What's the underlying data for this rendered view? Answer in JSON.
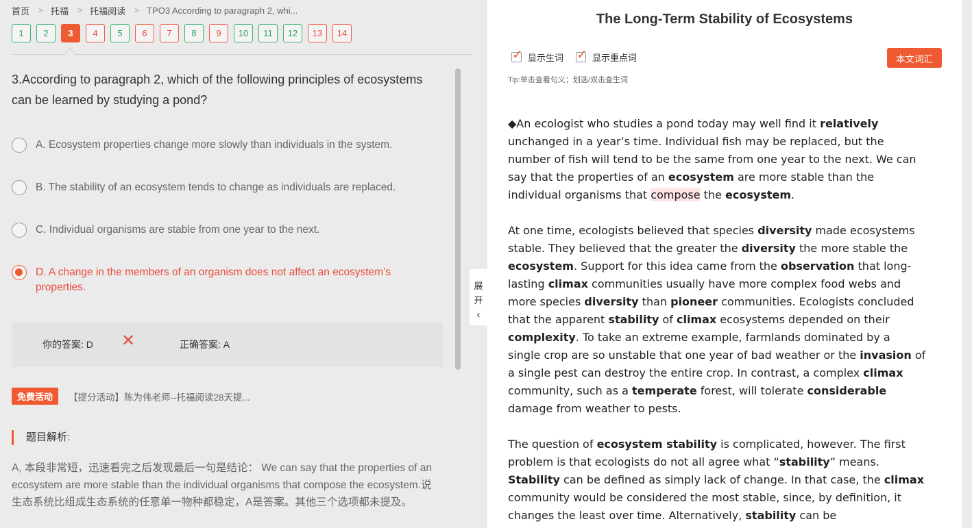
{
  "breadcrumb": {
    "items": [
      "首页",
      "托福",
      "托福阅读",
      "TPO3 According to paragraph 2, whi..."
    ],
    "separator": ">"
  },
  "question_nav": {
    "items": [
      {
        "label": "1",
        "status": "correct"
      },
      {
        "label": "2",
        "status": "correct"
      },
      {
        "label": "3",
        "status": "current"
      },
      {
        "label": "4",
        "status": "wrong"
      },
      {
        "label": "5",
        "status": "correct"
      },
      {
        "label": "6",
        "status": "wrong"
      },
      {
        "label": "7",
        "status": "wrong"
      },
      {
        "label": "8",
        "status": "correct"
      },
      {
        "label": "9",
        "status": "wrong"
      },
      {
        "label": "10",
        "status": "correct"
      },
      {
        "label": "11",
        "status": "correct"
      },
      {
        "label": "12",
        "status": "correct"
      },
      {
        "label": "13",
        "status": "wrong"
      },
      {
        "label": "14",
        "status": "wrong"
      }
    ]
  },
  "question": {
    "text": "3.According to paragraph 2, which of the following principles of ecosystems can be learned by studying a pond?",
    "options": [
      {
        "label": "A. Ecosystem properties change more slowly than individuals in the system.",
        "selected": false
      },
      {
        "label": "B. The stability of an ecosystem tends to change as individuals are replaced.",
        "selected": false
      },
      {
        "label": "C. Individual organisms are stable from one year to the next.",
        "selected": false
      },
      {
        "label": "D. A change in the members of an organism does not affect an ecosystem’s properties.",
        "selected": true
      }
    ]
  },
  "answer": {
    "your_label": "你的答案:",
    "your_value": "D",
    "result_icon": "x-icon",
    "correct_label": "正确答案:",
    "correct_value": "A"
  },
  "promo": {
    "badge": "免费活动",
    "text": "【提分活动】陈为伟老师--托福阅读28天提..."
  },
  "analysis": {
    "title": "题目解析:",
    "body": "A, 本段非常短，迅速看完之后发现最后一句是结论： We can say that the properties of an ecosystem are more stable than the individual organisms that compose the ecosystem.说生态系统比组成生态系统的任意单一物种都稳定，A是答案。其他三个选项都未提及。"
  },
  "toggle": {
    "chars": [
      "展",
      "开"
    ],
    "icon": "chevron-left-icon"
  },
  "article": {
    "title": "The Long-Term Stability of Ecosystems",
    "show_new_words": "显示生词",
    "show_key_words": "显示重点词",
    "show_new_words_checked": true,
    "show_key_words_checked": true,
    "vocab_button": "本文词汇",
    "tip": "Tip:单击查看句义；划选/双击查生词",
    "paragraphs": [
      [
        {
          "t": "◆An ecologist who studies a pond today may well find it "
        },
        {
          "t": "relatively",
          "b": true
        },
        {
          "t": " unchanged in a year’s time. Individual fish may be replaced, but the number of fish will tend to be the same from one year to the next. We can say that the properties of an "
        },
        {
          "t": "ecosystem",
          "b": true
        },
        {
          "t": " are more stable than the individual organisms that "
        },
        {
          "t": "compose",
          "hl": true
        },
        {
          "t": " the "
        },
        {
          "t": "ecosystem",
          "b": true
        },
        {
          "t": "."
        }
      ],
      [
        {
          "t": "At one time, ecologists believed that species "
        },
        {
          "t": "diversity",
          "b": true
        },
        {
          "t": " made ecosystems stable. They believed that the greater the "
        },
        {
          "t": "diversity",
          "b": true
        },
        {
          "t": " the more stable the "
        },
        {
          "t": "ecosystem",
          "b": true
        },
        {
          "t": ". Support for this idea came from the "
        },
        {
          "t": "observation",
          "b": true
        },
        {
          "t": " that long-lasting "
        },
        {
          "t": "climax",
          "b": true
        },
        {
          "t": " communities usually have more complex food webs and more species "
        },
        {
          "t": "diversity",
          "b": true
        },
        {
          "t": " than "
        },
        {
          "t": "pioneer",
          "b": true
        },
        {
          "t": " communities. Ecologists concluded that the apparent "
        },
        {
          "t": "stability",
          "b": true
        },
        {
          "t": " of "
        },
        {
          "t": "climax",
          "b": true
        },
        {
          "t": " ecosystems depended on their "
        },
        {
          "t": "complexity",
          "b": true
        },
        {
          "t": ". To take an extreme example, farmlands dominated by a single crop are so unstable that one year of bad weather or the "
        },
        {
          "t": "invasion",
          "b": true
        },
        {
          "t": " of a single pest can destroy the entire crop. In contrast, a complex "
        },
        {
          "t": "climax",
          "b": true
        },
        {
          "t": " community, such as a "
        },
        {
          "t": "temperate",
          "b": true
        },
        {
          "t": " forest, will tolerate "
        },
        {
          "t": "considerable",
          "b": true
        },
        {
          "t": " damage from weather to pests."
        }
      ],
      [
        {
          "t": "The question of "
        },
        {
          "t": "ecosystem stability",
          "b": true
        },
        {
          "t": " is complicated, however. The first problem is that ecologists do not all agree what “"
        },
        {
          "t": "stability",
          "b": true
        },
        {
          "t": "” means. "
        },
        {
          "t": "Stability",
          "b": true
        },
        {
          "t": " can be defined as simply lack of change. In that case, the "
        },
        {
          "t": "climax",
          "b": true
        },
        {
          "t": " community would be considered the most stable, since, by definition, it changes the least over time. Alternatively, "
        },
        {
          "t": "stability",
          "b": true
        },
        {
          "t": " can be"
        }
      ]
    ]
  },
  "colors": {
    "accent": "#f05a32",
    "correct": "#3cb371",
    "wrong": "#e84c3d",
    "panel_bg": "#ebebeb"
  }
}
